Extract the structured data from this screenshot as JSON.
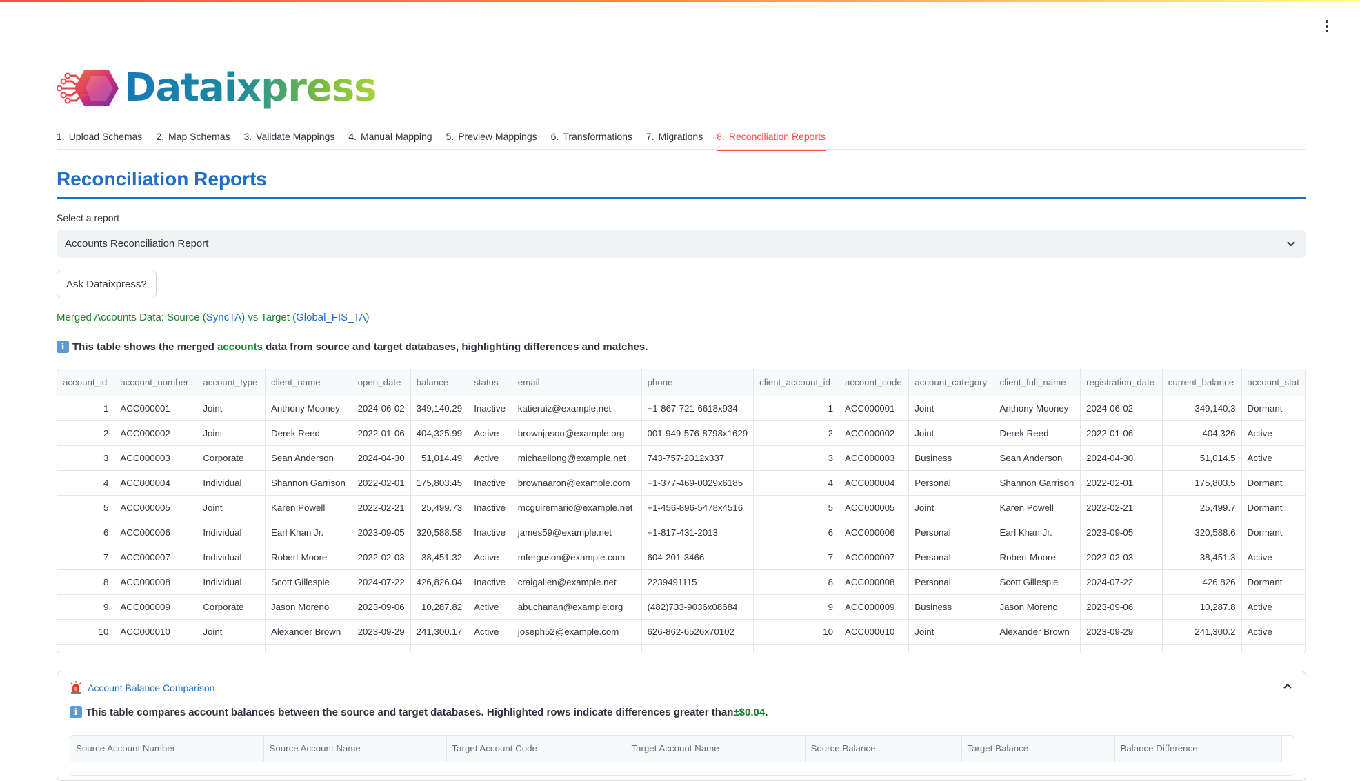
{
  "app": {
    "name": "Dataixpress"
  },
  "tabs": [
    {
      "num": "1.",
      "label": "Upload Schemas",
      "active": false
    },
    {
      "num": "2.",
      "label": "Map Schemas",
      "active": false
    },
    {
      "num": "3.",
      "label": "Validate Mappings",
      "active": false
    },
    {
      "num": "4.",
      "label": "Manual Mapping",
      "active": false
    },
    {
      "num": "5.",
      "label": "Preview Mappings",
      "active": false
    },
    {
      "num": "6.",
      "label": "Transformations",
      "active": false
    },
    {
      "num": "7.",
      "label": "Migrations",
      "active": false
    },
    {
      "num": "8.",
      "label": "Reconciliation Reports",
      "active": true
    }
  ],
  "page": {
    "title": "Reconciliation Reports"
  },
  "report_select": {
    "label": "Select a report",
    "value": "Accounts Reconciliation Report"
  },
  "ask_button": {
    "label": "Ask Dataixpress?"
  },
  "merged": {
    "prefix": "Merged Accounts Data: Source (",
    "source": "SyncTA",
    "mid": ") vs Target (",
    "target": "Global_FIS_TA",
    "suffix": ")"
  },
  "info": {
    "prefix": "This table shows the merged ",
    "highlight": "accounts",
    "suffix": " data from source and target databases, highlighting differences and matches."
  },
  "merged_table": {
    "columns": [
      "account_id",
      "account_number",
      "account_type",
      "client_name",
      "open_date",
      "balance",
      "status",
      "email",
      "phone",
      "client_account_id",
      "account_code",
      "account_category",
      "client_full_name",
      "registration_date",
      "current_balance",
      "account_stat"
    ],
    "rows": [
      [
        "1",
        "ACC000001",
        "Joint",
        "Anthony Mooney",
        "2024-06-02",
        "349,140.29",
        "Inactive",
        "katieruiz@example.net",
        "+1-867-721-6618x934",
        "1",
        "ACC000001",
        "Joint",
        "Anthony Mooney",
        "2024-06-02",
        "349,140.3",
        "Dormant"
      ],
      [
        "2",
        "ACC000002",
        "Joint",
        "Derek Reed",
        "2022-01-06",
        "404,325.99",
        "Active",
        "brownjason@example.org",
        "001-949-576-8798x1629",
        "2",
        "ACC000002",
        "Joint",
        "Derek Reed",
        "2022-01-06",
        "404,326",
        "Active"
      ],
      [
        "3",
        "ACC000003",
        "Corporate",
        "Sean Anderson",
        "2024-04-30",
        "51,014.49",
        "Active",
        "michaellong@example.net",
        "743-757-2012x337",
        "3",
        "ACC000003",
        "Business",
        "Sean Anderson",
        "2024-04-30",
        "51,014.5",
        "Active"
      ],
      [
        "4",
        "ACC000004",
        "Individual",
        "Shannon Garrison",
        "2022-02-01",
        "175,803.45",
        "Inactive",
        "brownaaron@example.com",
        "+1-377-469-0029x6185",
        "4",
        "ACC000004",
        "Personal",
        "Shannon Garrison",
        "2022-02-01",
        "175,803.5",
        "Dormant"
      ],
      [
        "5",
        "ACC000005",
        "Joint",
        "Karen Powell",
        "2022-02-21",
        "25,499.73",
        "Inactive",
        "mcguiremario@example.net",
        "+1-456-896-5478x4516",
        "5",
        "ACC000005",
        "Joint",
        "Karen Powell",
        "2022-02-21",
        "25,499.7",
        "Dormant"
      ],
      [
        "6",
        "ACC000006",
        "Individual",
        "Earl Khan Jr.",
        "2023-09-05",
        "320,588.58",
        "Inactive",
        "james59@example.net",
        "+1-817-431-2013",
        "6",
        "ACC000006",
        "Personal",
        "Earl Khan Jr.",
        "2023-09-05",
        "320,588.6",
        "Dormant"
      ],
      [
        "7",
        "ACC000007",
        "Individual",
        "Robert Moore",
        "2022-02-03",
        "38,451.32",
        "Active",
        "mferguson@example.com",
        "604-201-3466",
        "7",
        "ACC000007",
        "Personal",
        "Robert Moore",
        "2022-02-03",
        "38,451.3",
        "Active"
      ],
      [
        "8",
        "ACC000008",
        "Individual",
        "Scott Gillespie",
        "2024-07-22",
        "426,826.04",
        "Inactive",
        "craigallen@example.net",
        "2239491115",
        "8",
        "ACC000008",
        "Personal",
        "Scott Gillespie",
        "2024-07-22",
        "426,826",
        "Dormant"
      ],
      [
        "9",
        "ACC000009",
        "Corporate",
        "Jason Moreno",
        "2023-09-06",
        "10,287.82",
        "Active",
        "abuchanan@example.org",
        "(482)733-9036x08684",
        "9",
        "ACC000009",
        "Business",
        "Jason Moreno",
        "2023-09-06",
        "10,287.8",
        "Active"
      ],
      [
        "10",
        "ACC000010",
        "Joint",
        "Alexander Brown",
        "2023-09-29",
        "241,300.17",
        "Active",
        "joseph52@example.com",
        "626-862-6526x70102",
        "10",
        "ACC000010",
        "Joint",
        "Alexander Brown",
        "2023-09-29",
        "241,300.2",
        "Active"
      ]
    ]
  },
  "balance_comparison": {
    "title": "Account Balance Comparison",
    "info_prefix": "This table compares account balances between the source and target databases. Highlighted rows indicate differences greater than ",
    "threshold": "±$0.04",
    "info_suffix": ".",
    "columns": [
      "Source Account Number",
      "Source Account Name",
      "Target Account Code",
      "Target Account Name",
      "Source Balance",
      "Target Balance",
      "Balance Difference"
    ]
  },
  "colors": {
    "accent": "#ff4b4b",
    "title_blue": "#1f6fc5",
    "green_text": "#178332"
  },
  "icons": {
    "kebab": "kebab-menu-icon",
    "select": "chevron-down-icon",
    "info": "info-icon",
    "siren": "siren-icon",
    "expander": "chevron-up-icon"
  }
}
